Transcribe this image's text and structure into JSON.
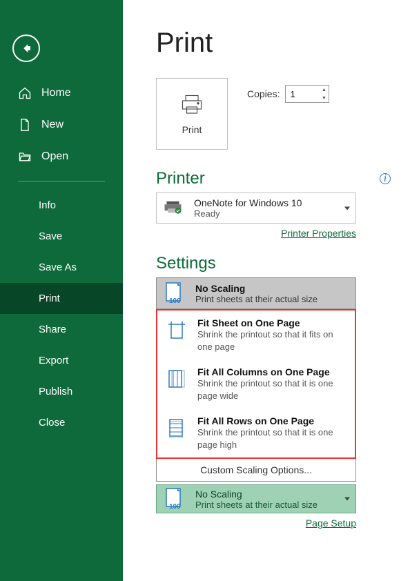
{
  "sidebar": {
    "primary": [
      {
        "label": "Home",
        "icon": "home-icon"
      },
      {
        "label": "New",
        "icon": "document-icon"
      },
      {
        "label": "Open",
        "icon": "folder-open-icon"
      }
    ],
    "secondary": [
      {
        "label": "Info"
      },
      {
        "label": "Save"
      },
      {
        "label": "Save As"
      },
      {
        "label": "Print",
        "active": true
      },
      {
        "label": "Share"
      },
      {
        "label": "Export"
      },
      {
        "label": "Publish"
      },
      {
        "label": "Close"
      }
    ]
  },
  "page": {
    "title": "Print"
  },
  "printTile": {
    "buttonLabel": "Print",
    "copiesLabel": "Copies:",
    "copiesValue": "1"
  },
  "printer": {
    "sectionTitle": "Printer",
    "name": "OneNote for Windows 10",
    "status": "Ready",
    "propertiesLink": "Printer Properties"
  },
  "settings": {
    "sectionTitle": "Settings",
    "current": {
      "title": "No Scaling",
      "desc": "Print sheets at their actual size"
    },
    "options": [
      {
        "title": "Fit Sheet on One Page",
        "desc": "Shrink the printout so that it fits on one page",
        "icon": "fit-sheet-icon"
      },
      {
        "title": "Fit All Columns on One Page",
        "desc": "Shrink the printout so that it is one page wide",
        "icon": "fit-columns-icon"
      },
      {
        "title": "Fit All Rows on One Page",
        "desc": "Shrink the printout so that it is one page high",
        "icon": "fit-rows-icon"
      }
    ],
    "customLabel": "Custom Scaling Options...",
    "selected": {
      "title": "No Scaling",
      "desc": "Print sheets at their actual size"
    },
    "pageSetupLink": "Page Setup"
  }
}
